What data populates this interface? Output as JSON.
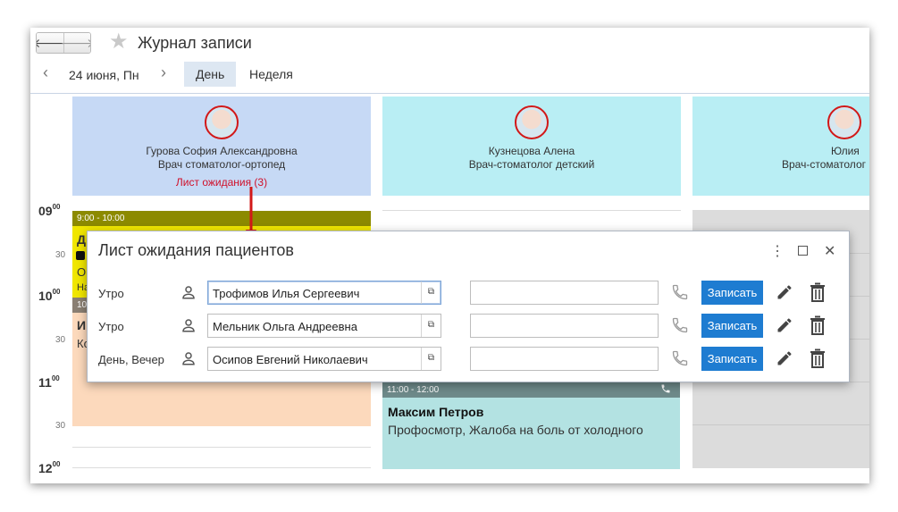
{
  "window": {
    "title": "Журнал записи"
  },
  "toolbar": {
    "date": "24 июня, Пн",
    "tab_day": "День",
    "tab_week": "Неделя"
  },
  "doctors": [
    {
      "name": "Гурова София Александровна",
      "spec": "Врач стоматолог-ортопед",
      "waitlist": "Лист ожидания (3)"
    },
    {
      "name": "Кузнецова Алена",
      "spec": "Врач-стоматолог детский"
    },
    {
      "name": "Юлия",
      "spec": "Врач-стоматолог"
    }
  ],
  "times": {
    "h9": "09",
    "h10": "10",
    "h11": "11",
    "h12": "12",
    "min00": "00",
    "half": "30"
  },
  "appointments": {
    "a1_time": "9:00 - 10:00",
    "a1_letter": "Д",
    "a1_letter2": "О",
    "a1_letter3": "На",
    "a2_time": "10",
    "a2_letter": "И",
    "a2_letter2": "Ко",
    "a3_time": "11:00 - 12:00",
    "a3_name": "Максим Петров",
    "a3_desc": "Профосмотр, Жалоба на боль от холодного"
  },
  "dialog": {
    "title": "Лист ожидания пациентов",
    "book_label": "Записать",
    "rows": [
      {
        "time": "Утро",
        "patient": "Трофимов Илья Сергеевич"
      },
      {
        "time": "Утро",
        "patient": "Мельник Ольга Андреевна"
      },
      {
        "time": "День, Вечер",
        "patient": "Осипов Евгений Николаевич"
      }
    ]
  },
  "colors": {
    "accent": "#1e7cd1",
    "waitlist": "#d0102a",
    "appt_olive": "#8c8a00",
    "appt_yellow": "#f0e600",
    "appt_peach": "#fcd9bc",
    "appt_teal": "#b3e2e2"
  }
}
